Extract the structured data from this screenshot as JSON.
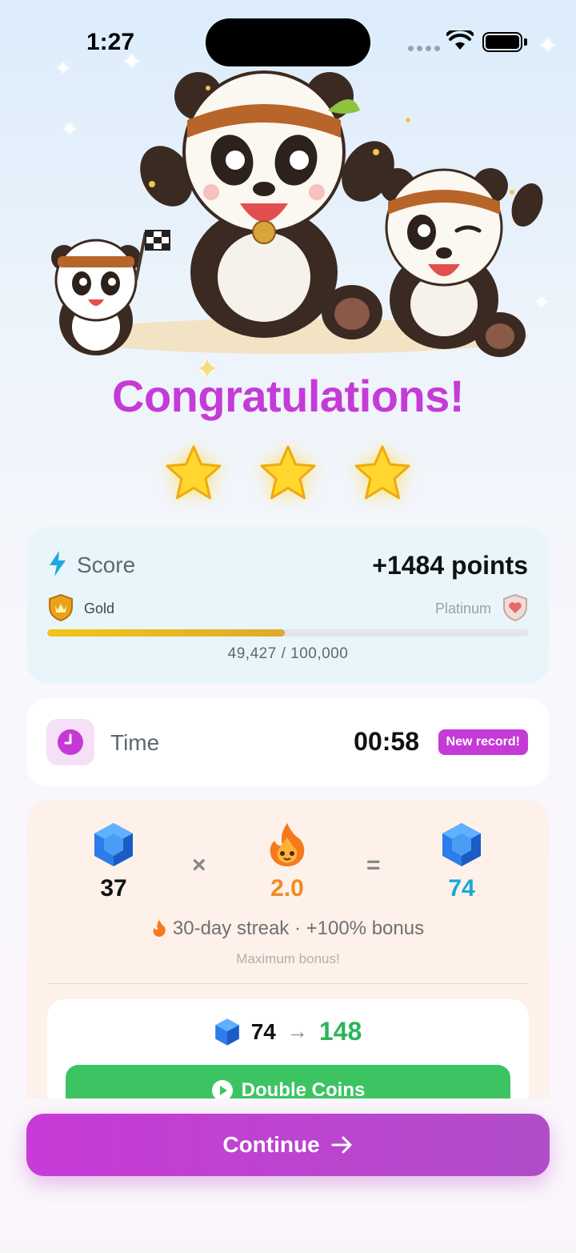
{
  "status": {
    "time": "1:27"
  },
  "hero": {
    "image_alt": "Three celebrating pandas"
  },
  "title": "Congratulations!",
  "stars": {
    "earned": 3,
    "total": 3
  },
  "score": {
    "label": "Score",
    "points": "+1484 points",
    "tier_current": "Gold",
    "tier_next": "Platinum",
    "progress_text": "49,427 / 100,000",
    "progress_fraction": 0.494
  },
  "time": {
    "label": "Time",
    "value": "00:58",
    "badge": "New record!"
  },
  "reward": {
    "base": "37",
    "operator_multiply": "×",
    "multiplier": "2.0",
    "operator_equals": "=",
    "result": "74",
    "streak_text": "30-day streak · +100% bonus",
    "max_text": "Maximum bonus!",
    "double_from": "74",
    "double_arrow": "→",
    "double_to": "148",
    "double_button": "Double Coins"
  },
  "continue_button": "Continue",
  "colors": {
    "accent": "#c43bd8",
    "green": "#3cc463",
    "gem": "#2b7de9",
    "multiplier": "#f08a22",
    "result": "#17a9d9"
  }
}
